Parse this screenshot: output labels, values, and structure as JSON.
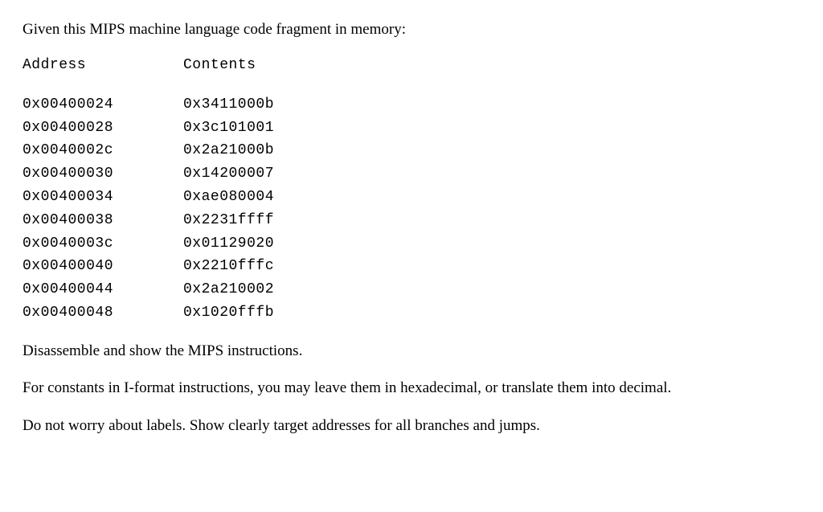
{
  "intro": "Given this MIPS machine language code fragment in memory:",
  "headers": {
    "address": "Address",
    "contents": "Contents"
  },
  "rows": [
    {
      "address": "0x00400024",
      "contents": "0x3411000b"
    },
    {
      "address": "0x00400028",
      "contents": "0x3c101001"
    },
    {
      "address": "0x0040002c",
      "contents": "0x2a21000b"
    },
    {
      "address": "0x00400030",
      "contents": "0x14200007"
    },
    {
      "address": "0x00400034",
      "contents": "0xae080004"
    },
    {
      "address": "0x00400038",
      "contents": "0x2231ffff"
    },
    {
      "address": "0x0040003c",
      "contents": "0x01129020"
    },
    {
      "address": "0x00400040",
      "contents": "0x2210fffc"
    },
    {
      "address": "0x00400044",
      "contents": "0x2a210002"
    },
    {
      "address": "0x00400048",
      "contents": "0x1020fffb"
    }
  ],
  "instructions": {
    "p1": "Disassemble and show the MIPS instructions.",
    "p2": "For constants in I-format instructions, you may leave them in hexadecimal, or translate them into decimal.",
    "p3": "Do not worry about labels. Show clearly target addresses for all branches and jumps."
  }
}
